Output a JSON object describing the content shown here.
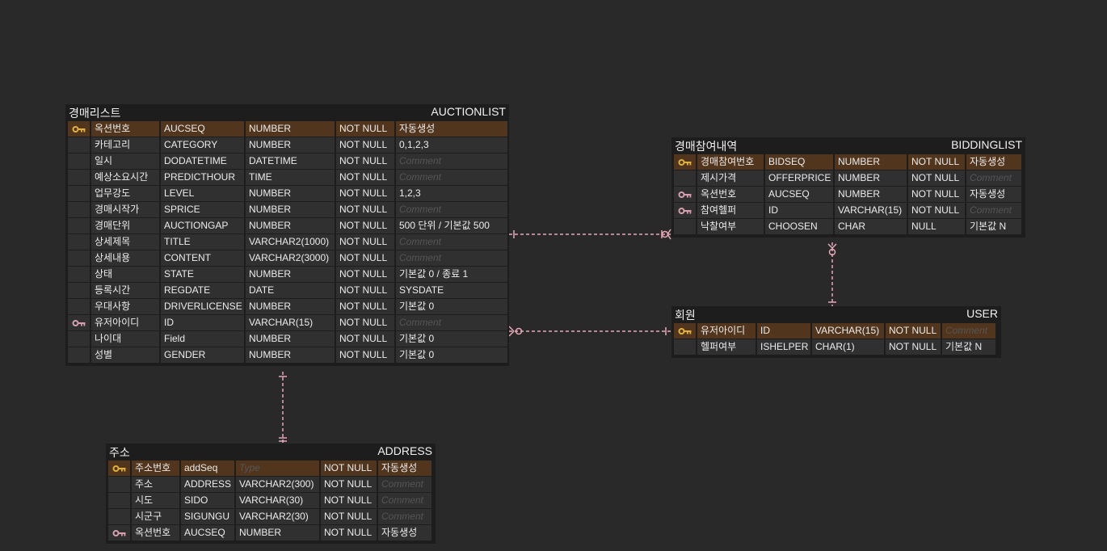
{
  "colors": {
    "pk_key": "#e0b13c",
    "fk_key": "#d7a0ae",
    "relation": "#e7a9b8",
    "pk_row": "#52351d"
  },
  "tables": {
    "auction": {
      "logical": "경매리스트",
      "physical": "AUCTIONLIST",
      "rows": [
        {
          "key": "pk",
          "name": "옥션번호",
          "col": "AUCSEQ",
          "type": "NUMBER",
          "null": "NOT NULL",
          "comment": "자동생성"
        },
        {
          "key": "",
          "name": "카테고리",
          "col": "CATEGORY",
          "type": "NUMBER",
          "null": "NOT NULL",
          "comment": "0,1,2,3"
        },
        {
          "key": "",
          "name": "일시",
          "col": "DODATETIME",
          "type": "DATETIME",
          "null": "NOT NULL",
          "comment": "Comment",
          "dim": true
        },
        {
          "key": "",
          "name": "예상소요시간",
          "col": "PREDICTHOUR",
          "type": "TIME",
          "null": "NOT NULL",
          "comment": "Comment",
          "dim": true
        },
        {
          "key": "",
          "name": "업무강도",
          "col": "LEVEL",
          "type": "NUMBER",
          "null": "NOT NULL",
          "comment": "1,2,3"
        },
        {
          "key": "",
          "name": "경매시작가",
          "col": "SPRICE",
          "type": "NUMBER",
          "null": "NOT NULL",
          "comment": "Comment",
          "dim": true
        },
        {
          "key": "",
          "name": "경매단위",
          "col": "AUCTIONGAP",
          "type": "NUMBER",
          "null": "NOT NULL",
          "comment": "500 단위 / 기본값 500"
        },
        {
          "key": "",
          "name": "상세제목",
          "col": "TITLE",
          "type": "VARCHAR2(1000)",
          "null": "NOT NULL",
          "comment": "Comment",
          "dim": true
        },
        {
          "key": "",
          "name": "상세내용",
          "col": "CONTENT",
          "type": "VARCHAR2(3000)",
          "null": "NOT NULL",
          "comment": "Comment",
          "dim": true
        },
        {
          "key": "",
          "name": "상태",
          "col": "STATE",
          "type": "NUMBER",
          "null": "NOT NULL",
          "comment": "기본값 0 / 종료 1"
        },
        {
          "key": "",
          "name": "등록시간",
          "col": "REGDATE",
          "type": "DATE",
          "null": "NOT NULL",
          "comment": "SYSDATE"
        },
        {
          "key": "",
          "name": "우대사항",
          "col": "DRIVERLICENSE",
          "type": "NUMBER",
          "null": "NOT NULL",
          "comment": "기본값 0"
        },
        {
          "key": "fk",
          "name": "유저아이디",
          "col": "ID",
          "type": "VARCHAR(15)",
          "null": "NOT NULL",
          "comment": "Comment",
          "dim": true
        },
        {
          "key": "",
          "name": "나이대",
          "col": "Field",
          "type": "NUMBER",
          "null": "NOT NULL",
          "comment": "기본값 0"
        },
        {
          "key": "",
          "name": "성별",
          "col": "GENDER",
          "type": "NUMBER",
          "null": "NOT NULL",
          "comment": "기본값 0"
        }
      ]
    },
    "bidding": {
      "logical": "경매참여내역",
      "physical": "BIDDINGLIST",
      "rows": [
        {
          "key": "pk",
          "name": "경매참여번호",
          "col": "BIDSEQ",
          "type": "NUMBER",
          "null": "NOT NULL",
          "comment": "자동생성"
        },
        {
          "key": "",
          "name": "제시가격",
          "col": "OFFERPRICE",
          "type": "NUMBER",
          "null": "NOT NULL",
          "comment": "Comment",
          "dim": true
        },
        {
          "key": "fk",
          "name": "옥션번호",
          "col": "AUCSEQ",
          "type": "NUMBER",
          "null": "NOT NULL",
          "comment": "자동생성"
        },
        {
          "key": "fk",
          "name": "참여헬퍼",
          "col": "ID",
          "type": "VARCHAR(15)",
          "null": "NOT NULL",
          "comment": "Comment",
          "dim": true
        },
        {
          "key": "",
          "name": "낙찰여부",
          "col": "CHOOSEN",
          "type": "CHAR",
          "null": "NULL",
          "comment": "기본값 N"
        }
      ]
    },
    "user": {
      "logical": "회원",
      "physical": "USER",
      "rows": [
        {
          "key": "pk",
          "name": "유저아이디",
          "col": "ID",
          "type": "VARCHAR(15)",
          "null": "NOT NULL",
          "comment": "Comment",
          "dim": true
        },
        {
          "key": "",
          "name": "헬퍼여부",
          "col": "ISHELPER",
          "type": "CHAR(1)",
          "null": "NOT NULL",
          "comment": "기본값 N"
        }
      ]
    },
    "address": {
      "logical": "주소",
      "physical": "ADDRESS",
      "rows": [
        {
          "key": "pk",
          "name": "주소번호",
          "col": "addSeq",
          "type": "Type",
          "type_dim": true,
          "null": "NOT NULL",
          "comment": "자동생성"
        },
        {
          "key": "",
          "name": "주소",
          "col": "ADDRESS",
          "type": "VARCHAR2(300)",
          "null": "NOT NULL",
          "comment": "Comment",
          "dim": true
        },
        {
          "key": "",
          "name": "시도",
          "col": "SIDO",
          "type": "VARCHAR(30)",
          "null": "NOT NULL",
          "comment": "Comment",
          "dim": true
        },
        {
          "key": "",
          "name": "시군구",
          "col": "SIGUNGU",
          "type": "VARCHAR2(30)",
          "null": "NOT NULL",
          "comment": "Comment",
          "dim": true
        },
        {
          "key": "fk",
          "name": "옥션번호",
          "col": "AUCSEQ",
          "type": "NUMBER",
          "null": "NOT NULL",
          "comment": "자동생성"
        }
      ]
    }
  }
}
